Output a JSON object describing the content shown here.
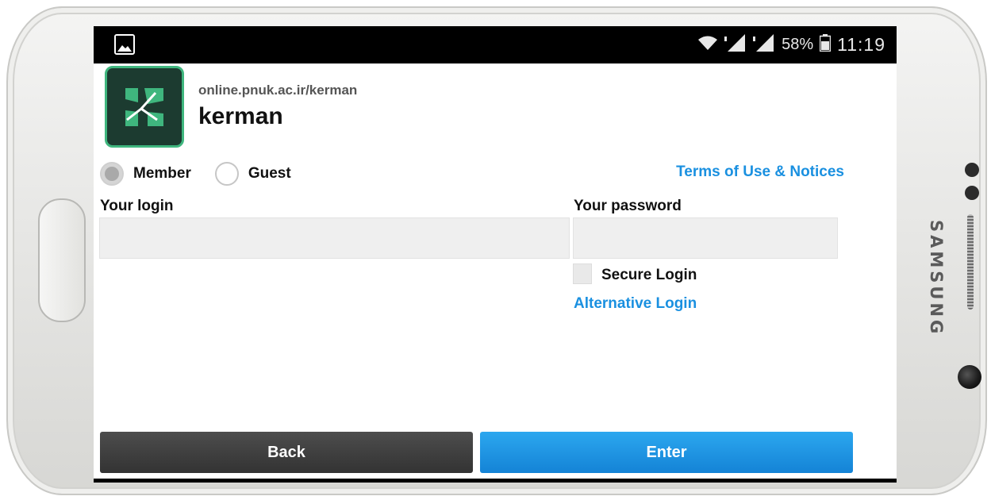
{
  "device": {
    "brand": "SAMSUNG"
  },
  "status_bar": {
    "battery": "58%",
    "time": "11:19"
  },
  "header": {
    "room_url": "online.pnuk.ac.ir/kerman",
    "room_name": "kerman"
  },
  "login_type": {
    "options": [
      {
        "label": "Member",
        "selected": true
      },
      {
        "label": "Guest",
        "selected": false
      }
    ]
  },
  "links": {
    "terms": "Terms of Use & Notices",
    "alternative_login": "Alternative Login"
  },
  "form": {
    "login_label": "Your login",
    "login_value": "",
    "password_label": "Your password",
    "password_value": "",
    "secure_login_label": "Secure Login",
    "secure_login_checked": false
  },
  "buttons": {
    "back": "Back",
    "enter": "Enter"
  },
  "colors": {
    "link": "#1a90e0",
    "enter_button": "#1c95e4",
    "back_button": "#404040",
    "app_icon_bg": "#1c3b30",
    "app_icon_accent": "#3fb67e"
  }
}
